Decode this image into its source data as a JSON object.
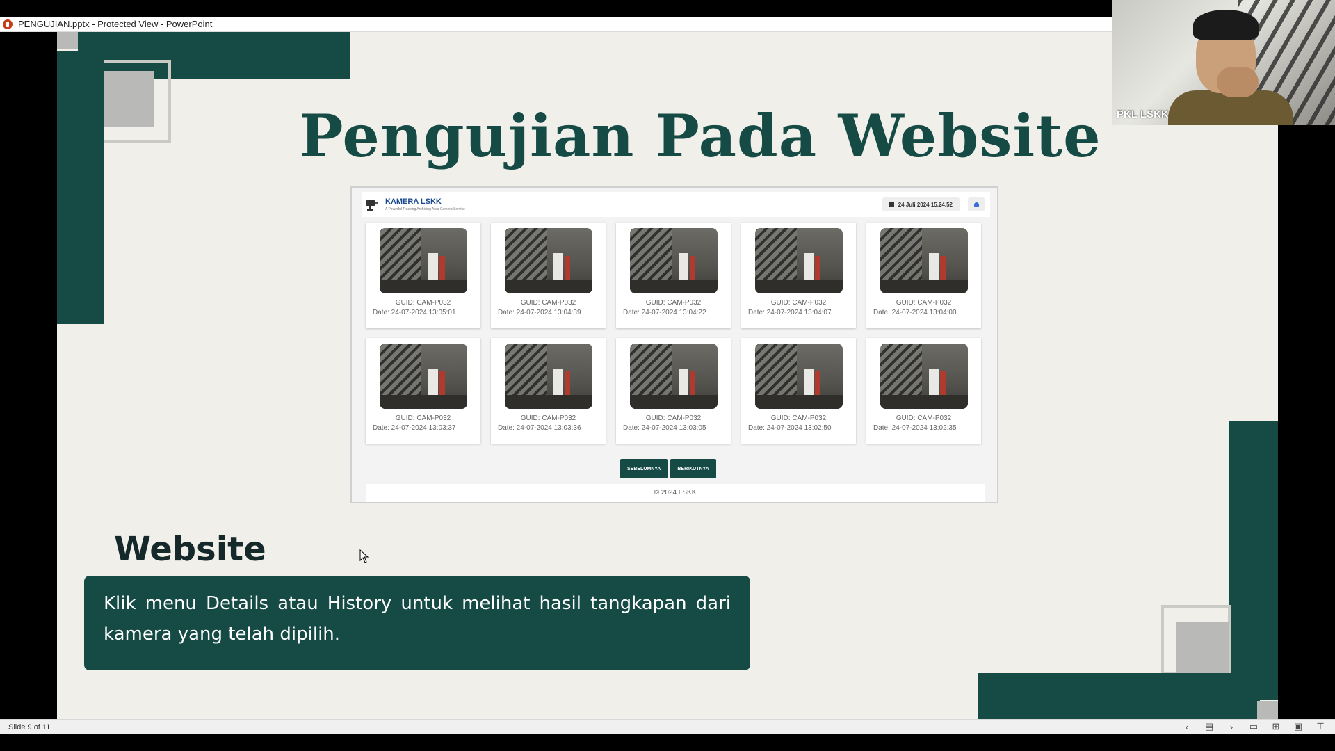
{
  "window": {
    "title": "PENGUJIAN.pptx  -  Protected View - PowerPoint"
  },
  "slide": {
    "title": "Pengujian Pada Website",
    "section_title": "Website",
    "description": "Klik menu Details atau History untuk melihat hasil tangkapan dari kamera yang telah dipilih.",
    "colors": {
      "accent": "#154a45",
      "background": "#f1efea"
    }
  },
  "website": {
    "brand": "KAMERA LSKK",
    "tagline": "A Powerful Tracking Archiving Area Camera Service",
    "datetime": "24 Juli 2024 15.24.52",
    "cards": [
      {
        "guid": "GUID: CAM-P032",
        "date": "Date: 24-07-2024 13:05:01"
      },
      {
        "guid": "GUID: CAM-P032",
        "date": "Date: 24-07-2024 13:04:39"
      },
      {
        "guid": "GUID: CAM-P032",
        "date": "Date: 24-07-2024 13:04:22"
      },
      {
        "guid": "GUID: CAM-P032",
        "date": "Date: 24-07-2024 13:04:07"
      },
      {
        "guid": "GUID: CAM-P032",
        "date": "Date: 24-07-2024 13:04:00"
      },
      {
        "guid": "GUID: CAM-P032",
        "date": "Date: 24-07-2024 13:03:37"
      },
      {
        "guid": "GUID: CAM-P032",
        "date": "Date: 24-07-2024 13:03:36"
      },
      {
        "guid": "GUID: CAM-P032",
        "date": "Date: 24-07-2024 13:03:05"
      },
      {
        "guid": "GUID: CAM-P032",
        "date": "Date: 24-07-2024 13:02:50"
      },
      {
        "guid": "GUID: CAM-P032",
        "date": "Date: 24-07-2024 13:02:35"
      }
    ],
    "prev_label": "SEBELUMNYA",
    "next_label": "BERIKUTNYA",
    "footer": "© 2024 LSKK"
  },
  "statusbar": {
    "slide_indicator": "Slide 9 of 11"
  },
  "webcam": {
    "participant_name": "PKL LSKK"
  }
}
